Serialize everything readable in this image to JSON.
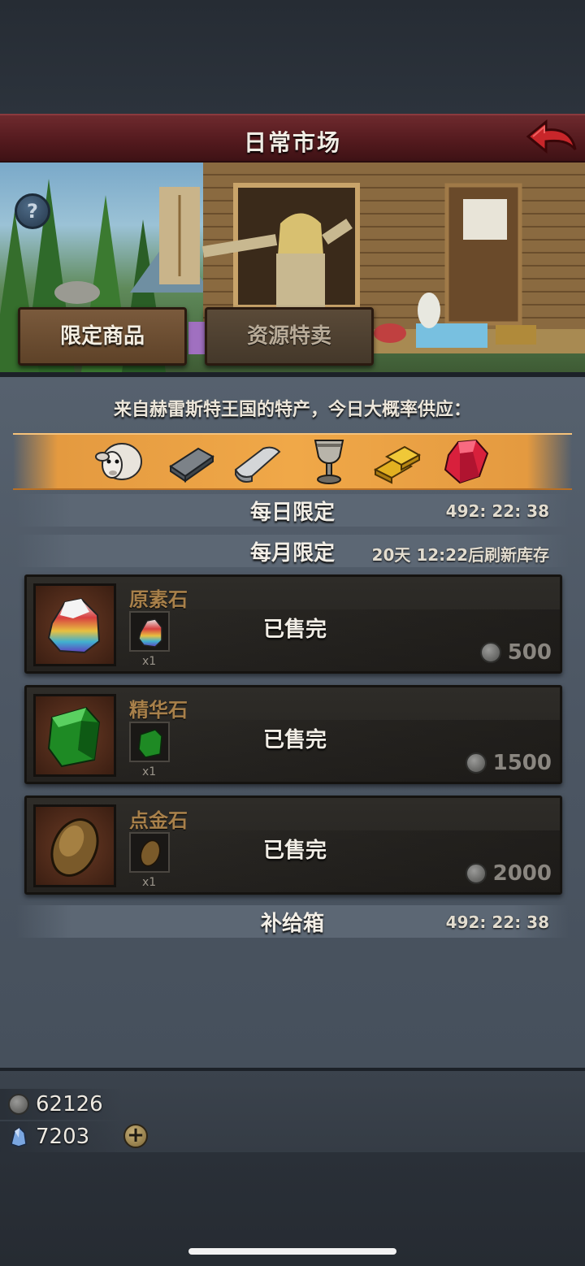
{
  "header": {
    "title": "日常市场"
  },
  "tabs": [
    {
      "label": "限定商品",
      "active": true
    },
    {
      "label": "资源特卖",
      "active": false
    }
  ],
  "specialty": {
    "text": "来自赫雷斯特王国的特产，今日大概率供应：",
    "goods_icons": [
      "sheep-icon",
      "iron-ingot-icon",
      "silver-ingot-icon",
      "goblet-icon",
      "gold-bars-icon",
      "ruby-icon"
    ]
  },
  "sections": {
    "daily": {
      "title": "每日限定",
      "timer": "492: 22: 38"
    },
    "monthly": {
      "title": "每月限定",
      "timer": "20天 12:22后刷新库存"
    },
    "supply": {
      "title": "补给箱",
      "timer": "492: 22: 38"
    }
  },
  "items": [
    {
      "name": "原素石",
      "qty": "x1",
      "status": "已售完",
      "price": "500",
      "icon": "element-stone-icon"
    },
    {
      "name": "精华石",
      "qty": "x1",
      "status": "已售完",
      "price": "1500",
      "icon": "essence-stone-icon"
    },
    {
      "name": "点金石",
      "qty": "x1",
      "status": "已售完",
      "price": "2000",
      "icon": "gold-stone-icon"
    }
  ],
  "currency": {
    "silver": "62126",
    "gems": "7203"
  },
  "colors": {
    "title_bar": "#52191d",
    "goods_strip": "#f0a848",
    "item_name": "#a8804a",
    "panel": "#4c5663"
  }
}
